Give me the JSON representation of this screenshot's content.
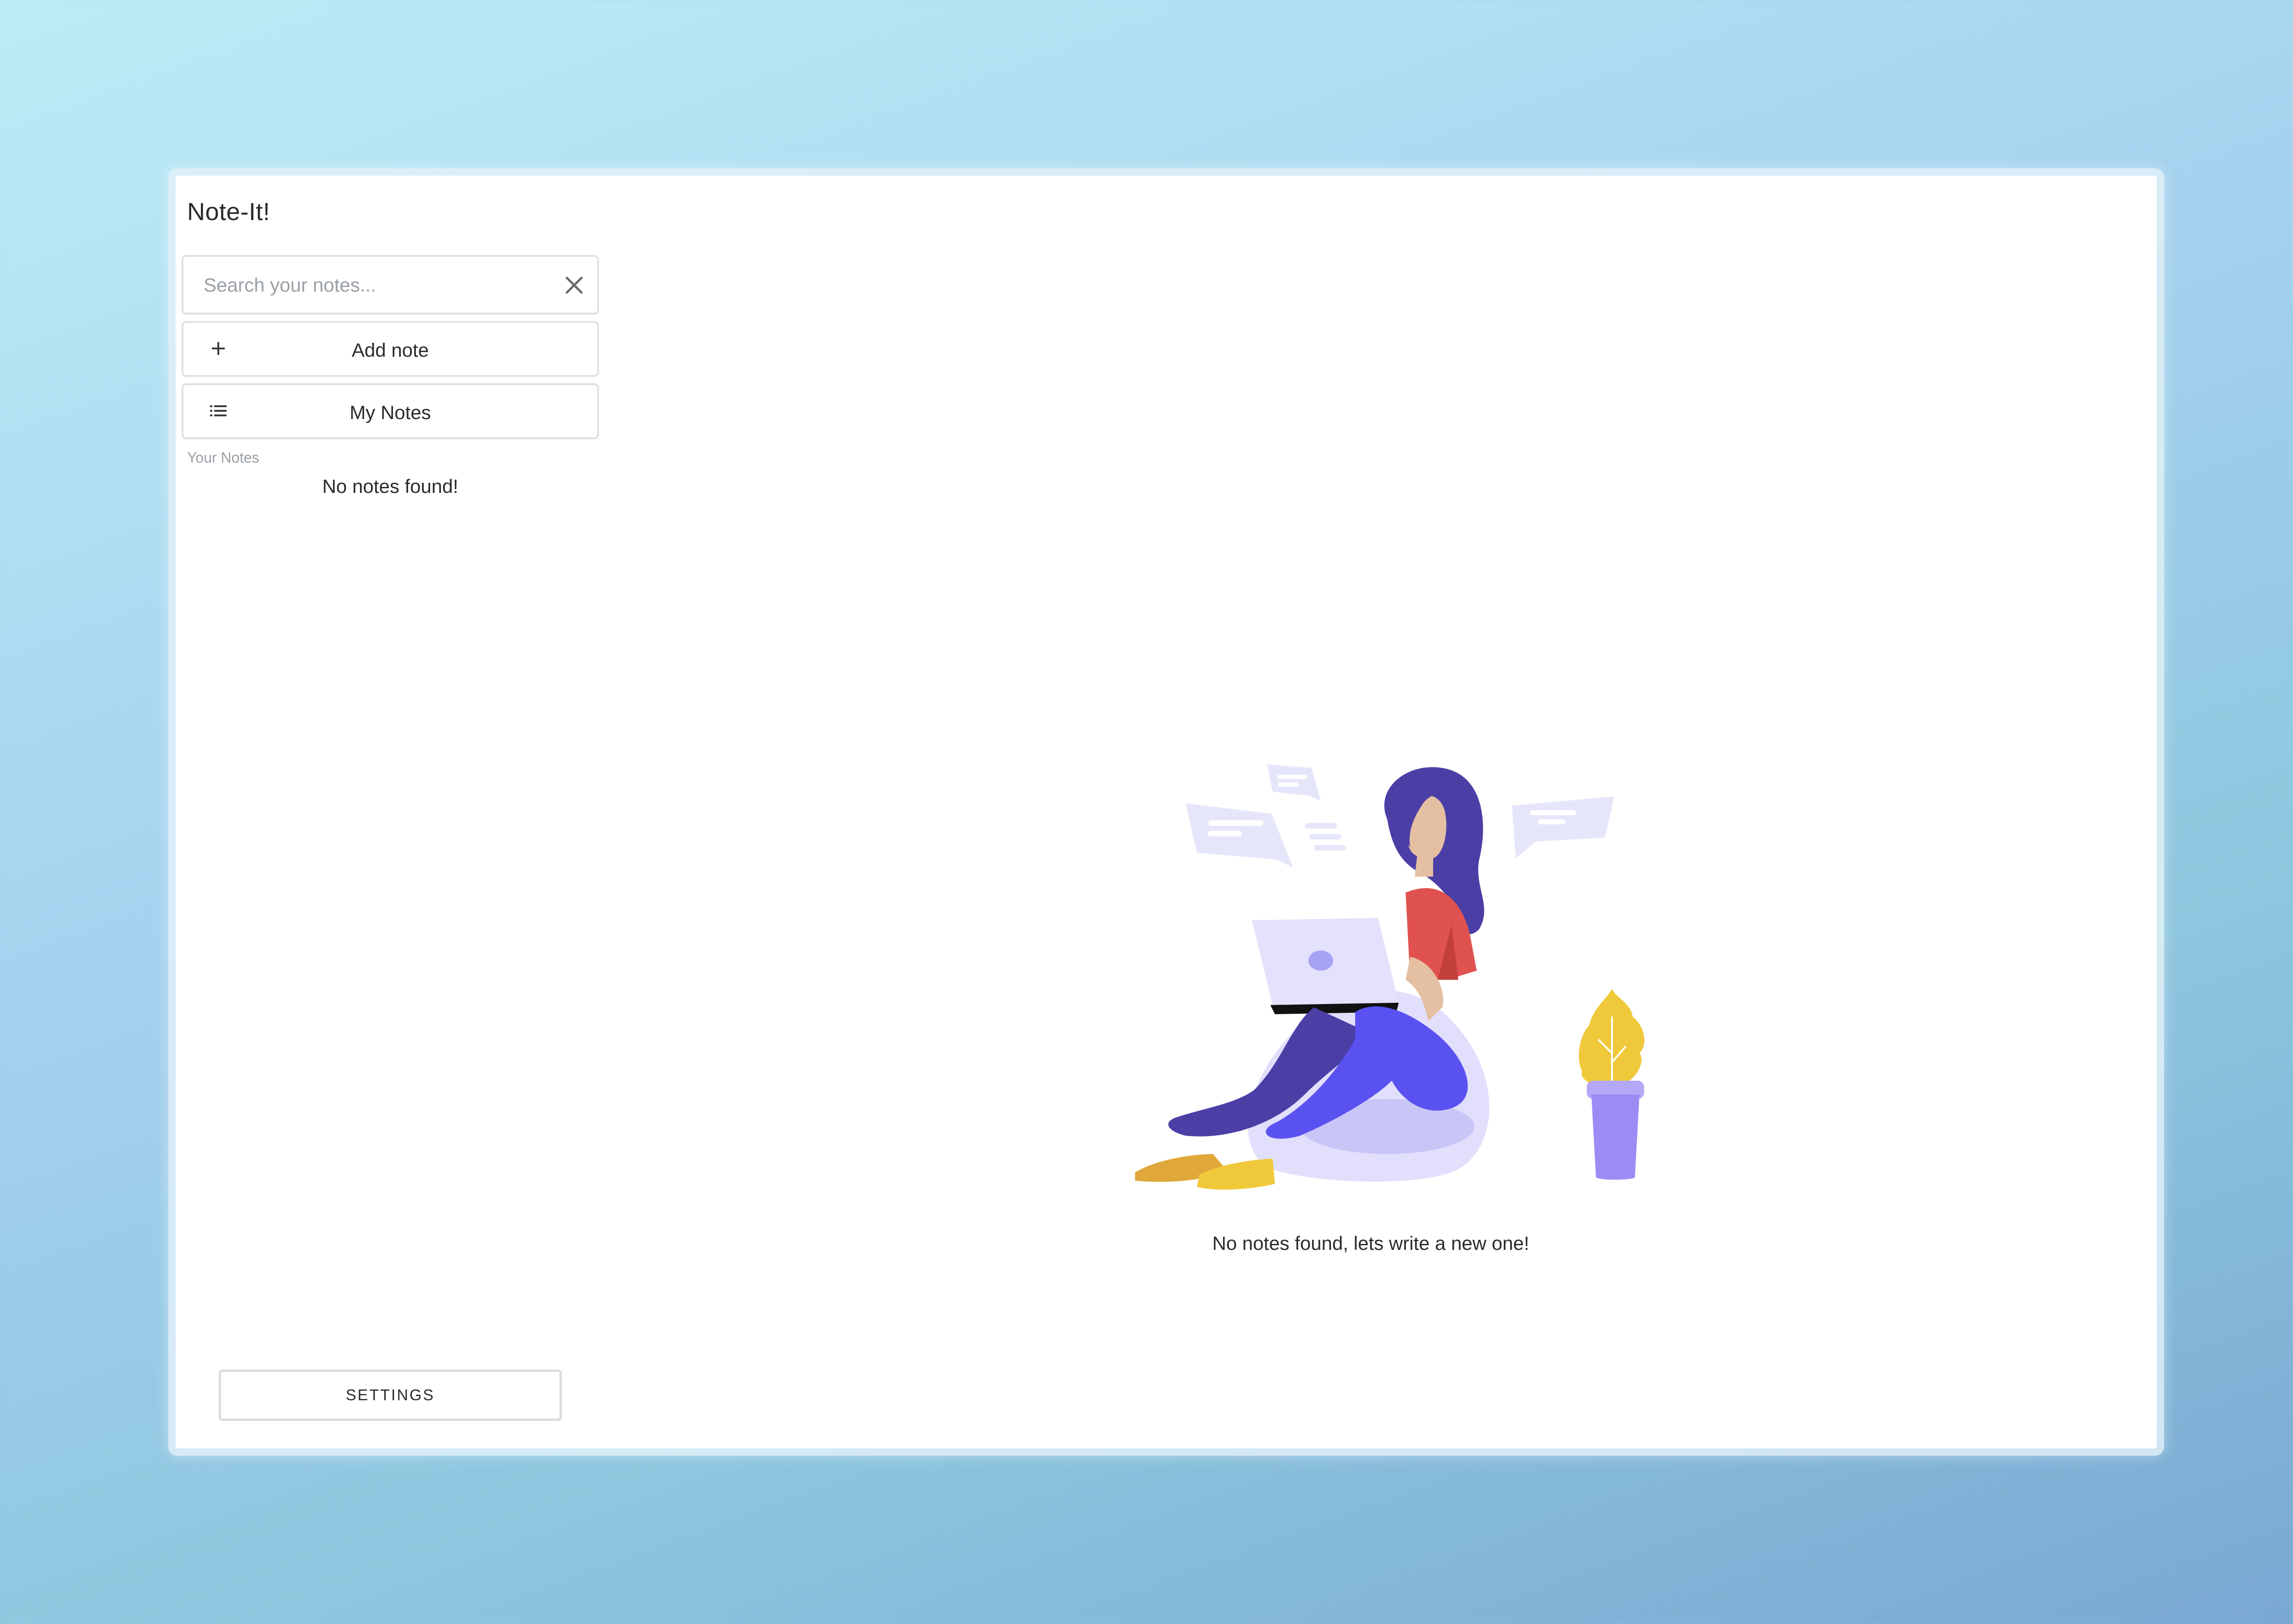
{
  "app": {
    "title": "Note-It!"
  },
  "search": {
    "placeholder": "Search your notes...",
    "value": ""
  },
  "sidebar": {
    "add_note_label": "Add note",
    "my_notes_label": "My Notes",
    "section_label": "Your Notes",
    "empty_text": "No notes found!",
    "settings_label": "SETTINGS"
  },
  "main": {
    "empty_text": "No notes found, lets write a new one!"
  },
  "colors": {
    "background_start": "#bcecf5",
    "background_end": "#7aa8d3",
    "accent_purple": "#5a52f0",
    "hair": "#4b3fa6",
    "shirt": "#e0524f",
    "plant": "#f0c93a",
    "pot": "#9b8cf5",
    "bubble": "#e6e6fb"
  },
  "icons": {
    "clear": "close-icon",
    "add": "plus-icon",
    "list": "list-icon"
  }
}
